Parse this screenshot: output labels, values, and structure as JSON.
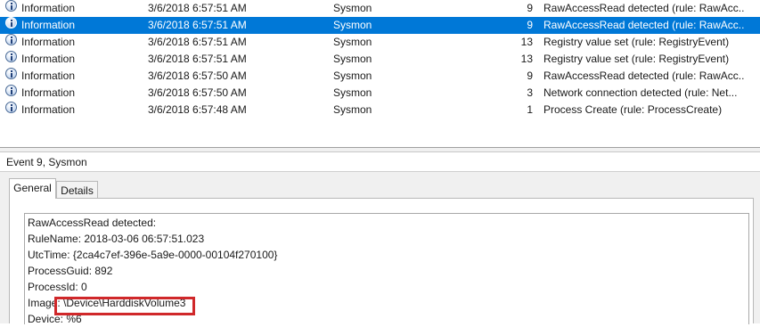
{
  "event_list": {
    "rows": [
      {
        "level": "Information",
        "date": "3/6/2018 6:57:51 AM",
        "source": "Sysmon",
        "event_id": "9",
        "task": "RawAccessRead detected (rule: RawAcc..."
      },
      {
        "level": "Information",
        "date": "3/6/2018 6:57:51 AM",
        "source": "Sysmon",
        "event_id": "9",
        "task": "RawAccessRead detected (rule: RawAcc...",
        "selected": true
      },
      {
        "level": "Information",
        "date": "3/6/2018 6:57:51 AM",
        "source": "Sysmon",
        "event_id": "13",
        "task": "Registry value set (rule: RegistryEvent)"
      },
      {
        "level": "Information",
        "date": "3/6/2018 6:57:51 AM",
        "source": "Sysmon",
        "event_id": "13",
        "task": "Registry value set (rule: RegistryEvent)"
      },
      {
        "level": "Information",
        "date": "3/6/2018 6:57:50 AM",
        "source": "Sysmon",
        "event_id": "9",
        "task": "RawAccessRead detected (rule: RawAcc..."
      },
      {
        "level": "Information",
        "date": "3/6/2018 6:57:50 AM",
        "source": "Sysmon",
        "event_id": "3",
        "task": "Network connection detected (rule: Net..."
      },
      {
        "level": "Information",
        "date": "3/6/2018 6:57:48 AM",
        "source": "Sysmon",
        "event_id": "1",
        "task": "Process Create (rule: ProcessCreate)"
      }
    ]
  },
  "details": {
    "title": "Event 9, Sysmon",
    "tabs": {
      "general": "General",
      "details": "Details"
    },
    "message_lines": [
      "RawAccessRead detected:",
      "RuleName: 2018-03-06 06:57:51.023",
      "UtcTime: {2ca4c7ef-396e-5a9e-0000-00104f270100}",
      "ProcessGuid: 892",
      "ProcessId: 0",
      "Image: \\Device\\HarddiskVolume3",
      "Device: %6"
    ]
  },
  "colors": {
    "selection": "#0078d7",
    "highlight": "#d0282a"
  }
}
